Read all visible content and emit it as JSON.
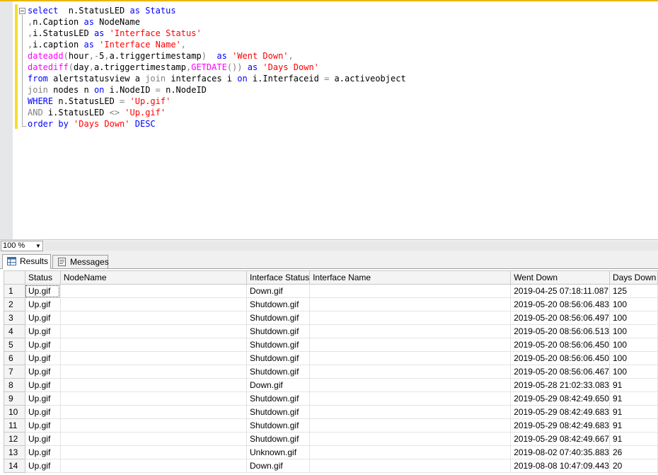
{
  "editor": {
    "lines": [
      [
        {
          "t": "select",
          "c": "kw"
        },
        {
          "t": "  n.StatusLED ",
          "c": "tx"
        },
        {
          "t": "as",
          "c": "kw"
        },
        {
          "t": " ",
          "c": "tx"
        },
        {
          "t": "Status",
          "c": "kw"
        }
      ],
      [
        {
          "t": ",",
          "c": "gr"
        },
        {
          "t": "n.Caption ",
          "c": "tx"
        },
        {
          "t": "as",
          "c": "kw"
        },
        {
          "t": " NodeName",
          "c": "tx"
        }
      ],
      [
        {
          "t": ",",
          "c": "gr"
        },
        {
          "t": "i.StatusLED ",
          "c": "tx"
        },
        {
          "t": "as",
          "c": "kw"
        },
        {
          "t": " ",
          "c": "tx"
        },
        {
          "t": "'Interface Status'",
          "c": "st"
        }
      ],
      [
        {
          "t": ",",
          "c": "gr"
        },
        {
          "t": "i.caption ",
          "c": "tx"
        },
        {
          "t": "as",
          "c": "kw"
        },
        {
          "t": " ",
          "c": "tx"
        },
        {
          "t": "'Interface Name'",
          "c": "st"
        },
        {
          "t": ",",
          "c": "gr"
        }
      ],
      [
        {
          "t": "dateadd",
          "c": "fn"
        },
        {
          "t": "(",
          "c": "gr"
        },
        {
          "t": "hour",
          "c": "tx"
        },
        {
          "t": ",-",
          "c": "gr"
        },
        {
          "t": "5",
          "c": "tx"
        },
        {
          "t": ",",
          "c": "gr"
        },
        {
          "t": "a.triggertimestamp",
          "c": "tx"
        },
        {
          "t": ")",
          "c": "gr"
        },
        {
          "t": "  ",
          "c": "tx"
        },
        {
          "t": "as",
          "c": "kw"
        },
        {
          "t": " ",
          "c": "tx"
        },
        {
          "t": "'Went Down'",
          "c": "st"
        },
        {
          "t": ",",
          "c": "gr"
        }
      ],
      [
        {
          "t": "datediff",
          "c": "fn"
        },
        {
          "t": "(",
          "c": "gr"
        },
        {
          "t": "day",
          "c": "tx"
        },
        {
          "t": ",",
          "c": "gr"
        },
        {
          "t": "a.triggertimestamp",
          "c": "tx"
        },
        {
          "t": ",",
          "c": "gr"
        },
        {
          "t": "GETDATE",
          "c": "fn"
        },
        {
          "t": "())",
          "c": "gr"
        },
        {
          "t": " ",
          "c": "tx"
        },
        {
          "t": "as",
          "c": "kw"
        },
        {
          "t": " ",
          "c": "tx"
        },
        {
          "t": "'Days Down'",
          "c": "st"
        }
      ],
      [
        {
          "t": "from",
          "c": "kw"
        },
        {
          "t": " alertstatusview a ",
          "c": "tx"
        },
        {
          "t": "join",
          "c": "gr"
        },
        {
          "t": " interfaces i ",
          "c": "tx"
        },
        {
          "t": "on",
          "c": "kw"
        },
        {
          "t": " i.Interfaceid ",
          "c": "tx"
        },
        {
          "t": "=",
          "c": "gr"
        },
        {
          "t": " a.activeobject",
          "c": "tx"
        }
      ],
      [
        {
          "t": "join",
          "c": "gr"
        },
        {
          "t": " nodes n ",
          "c": "tx"
        },
        {
          "t": "on",
          "c": "kw"
        },
        {
          "t": " i.NodeID ",
          "c": "tx"
        },
        {
          "t": "=",
          "c": "gr"
        },
        {
          "t": " n.NodeID",
          "c": "tx"
        }
      ],
      [
        {
          "t": "WHERE",
          "c": "kw"
        },
        {
          "t": " n.StatusLED ",
          "c": "tx"
        },
        {
          "t": "=",
          "c": "gr"
        },
        {
          "t": " ",
          "c": "tx"
        },
        {
          "t": "'Up.gif'",
          "c": "st"
        }
      ],
      [
        {
          "t": "AND",
          "c": "gr"
        },
        {
          "t": " i.StatusLED ",
          "c": "tx"
        },
        {
          "t": "<>",
          "c": "gr"
        },
        {
          "t": " ",
          "c": "tx"
        },
        {
          "t": "'Up.gif'",
          "c": "st"
        }
      ],
      [
        {
          "t": "order by",
          "c": "kw"
        },
        {
          "t": " ",
          "c": "tx"
        },
        {
          "t": "'Days Down'",
          "c": "st"
        },
        {
          "t": " ",
          "c": "tx"
        },
        {
          "t": "DESC",
          "c": "kw"
        }
      ]
    ]
  },
  "zoom": {
    "value": "100 %"
  },
  "tabs": {
    "results": "Results",
    "messages": "Messages"
  },
  "grid": {
    "columns": [
      "",
      "Status",
      "NodeName",
      "Interface Status",
      "Interface Name",
      "Went Down",
      "Days Down"
    ],
    "rows": [
      [
        "1",
        "Up.gif",
        "",
        "Down.gif",
        "",
        "2019-04-25 07:18:11.087",
        "125"
      ],
      [
        "2",
        "Up.gif",
        "",
        "Shutdown.gif",
        "",
        "2019-05-20 08:56:06.483",
        "100"
      ],
      [
        "3",
        "Up.gif",
        "",
        "Shutdown.gif",
        "",
        "2019-05-20 08:56:06.497",
        "100"
      ],
      [
        "4",
        "Up.gif",
        "",
        "Shutdown.gif",
        "",
        "2019-05-20 08:56:06.513",
        "100"
      ],
      [
        "5",
        "Up.gif",
        "",
        "Shutdown.gif",
        "",
        "2019-05-20 08:56:06.450",
        "100"
      ],
      [
        "6",
        "Up.gif",
        "",
        "Shutdown.gif",
        "",
        "2019-05-20 08:56:06.450",
        "100"
      ],
      [
        "7",
        "Up.gif",
        "",
        "Shutdown.gif",
        "",
        "2019-05-20 08:56:06.467",
        "100"
      ],
      [
        "8",
        "Up.gif",
        "",
        "Down.gif",
        "",
        "2019-05-28 21:02:33.083",
        "91"
      ],
      [
        "9",
        "Up.gif",
        "",
        "Shutdown.gif",
        "",
        "2019-05-29 08:42:49.650",
        "91"
      ],
      [
        "10",
        "Up.gif",
        "",
        "Shutdown.gif",
        "",
        "2019-05-29 08:42:49.683",
        "91"
      ],
      [
        "11",
        "Up.gif",
        "",
        "Shutdown.gif",
        "",
        "2019-05-29 08:42:49.683",
        "91"
      ],
      [
        "12",
        "Up.gif",
        "",
        "Shutdown.gif",
        "",
        "2019-05-29 08:42:49.667",
        "91"
      ],
      [
        "13",
        "Up.gif",
        "",
        "Unknown.gif",
        "",
        "2019-08-02 07:40:35.883",
        "26"
      ],
      [
        "14",
        "Up.gif",
        "",
        "Down.gif",
        "",
        "2019-08-08 10:47:09.443",
        "20"
      ]
    ]
  }
}
